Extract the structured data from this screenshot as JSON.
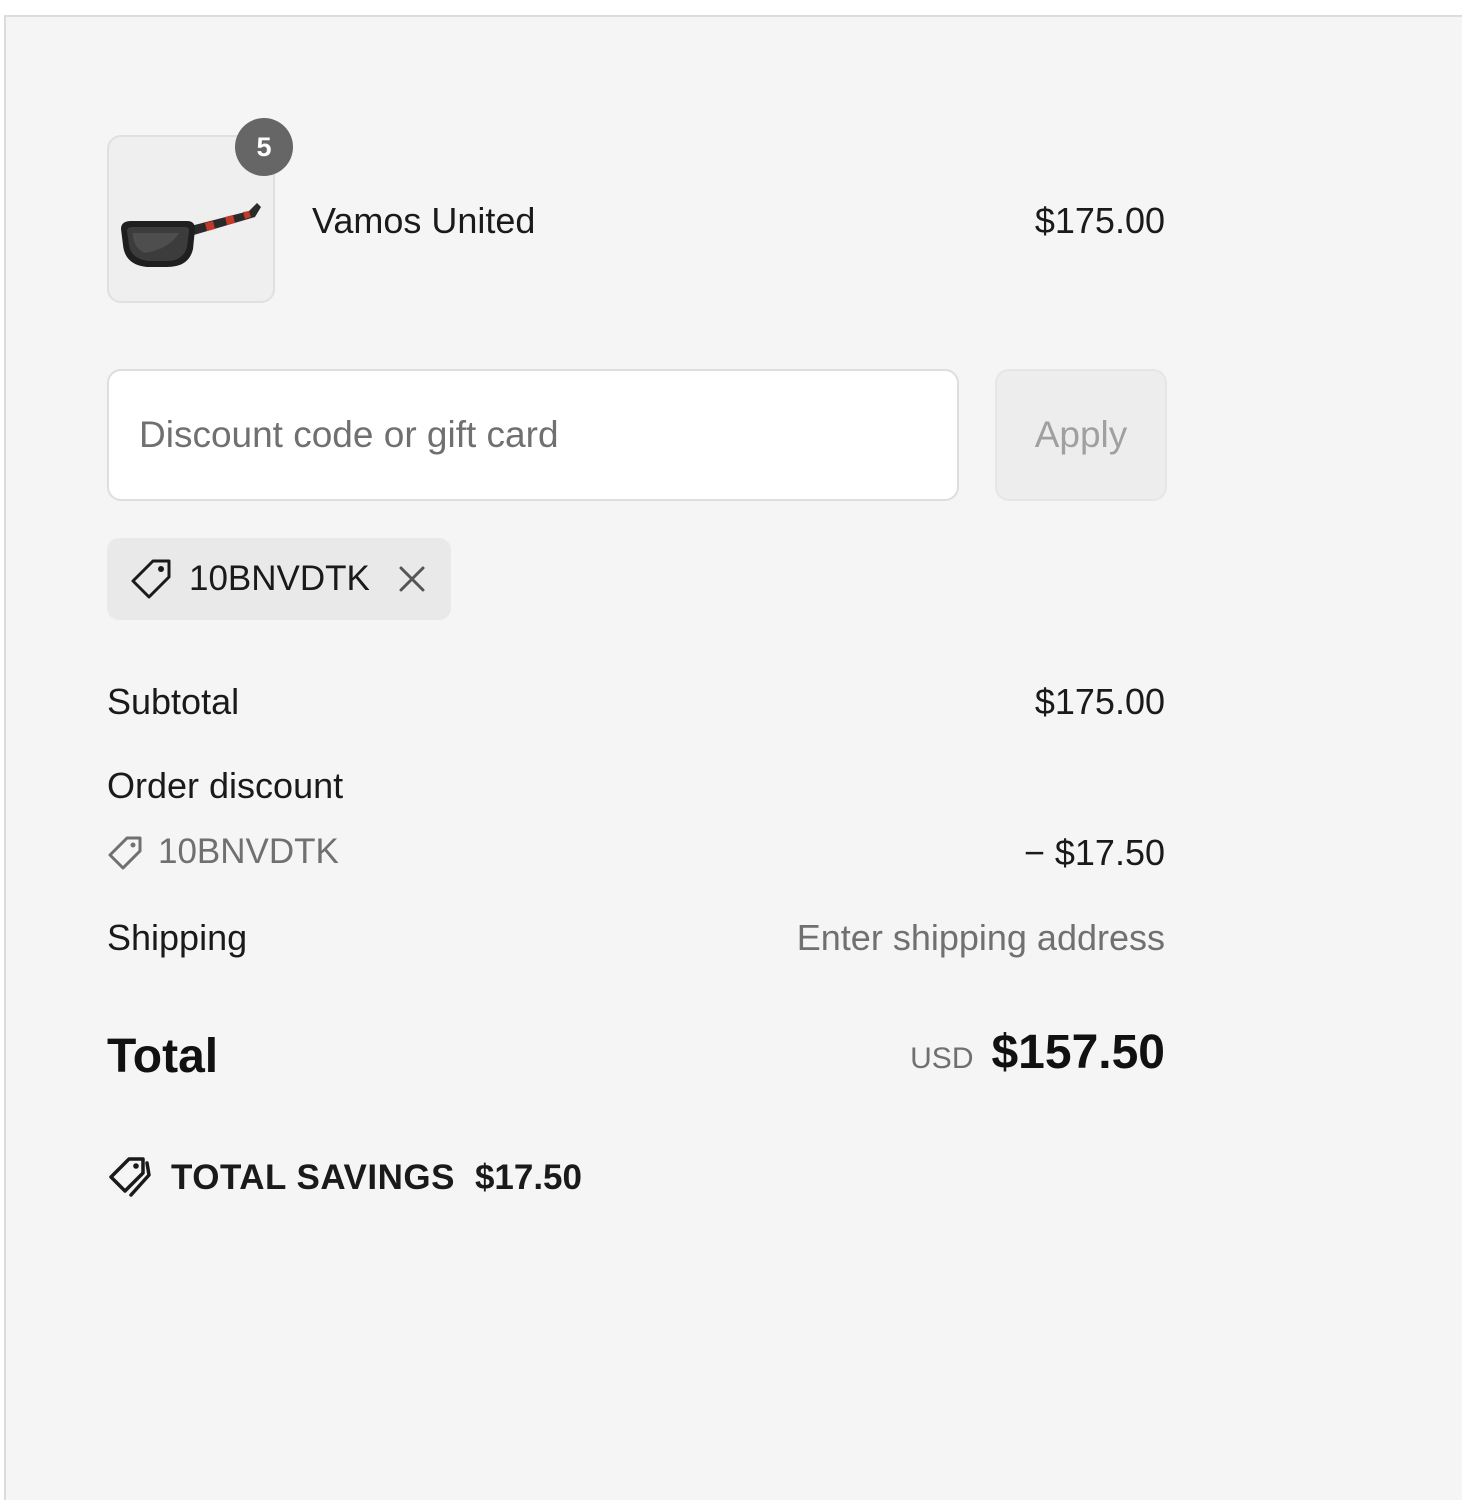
{
  "product": {
    "name": "Vamos United",
    "price": "$175.00",
    "quantity": "5",
    "image_icon": "sunglasses-icon"
  },
  "discount_form": {
    "placeholder": "Discount code or gift card",
    "value": "",
    "apply_label": "Apply"
  },
  "applied_code": {
    "code": "10BNVDTK",
    "tag_icon": "tag-icon",
    "remove_icon": "close-icon"
  },
  "summary": {
    "subtotal_label": "Subtotal",
    "subtotal_value": "$175.00",
    "order_discount_label": "Order discount",
    "discount_code": "10BNVDTK",
    "discount_value": "− $17.50",
    "shipping_label": "Shipping",
    "shipping_value": "Enter shipping address",
    "total_label": "Total",
    "currency": "USD",
    "total_value": "$157.50"
  },
  "savings": {
    "label": "TOTAL SAVINGS",
    "amount": "$17.50",
    "icon": "tags-icon"
  },
  "colors": {
    "panel_background": "#f5f5f5",
    "badge_background": "#666666",
    "muted_text": "#707070"
  }
}
